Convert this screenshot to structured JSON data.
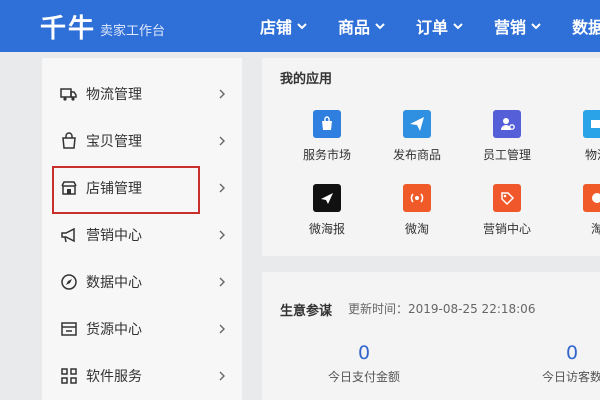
{
  "header": {
    "logo": "千牛",
    "subtitle": "卖家工作台",
    "nav": [
      "店铺",
      "商品",
      "订单",
      "营销",
      "数据"
    ]
  },
  "sidebar": {
    "items": [
      {
        "label": "物流管理",
        "icon": "truck-icon"
      },
      {
        "label": "宝贝管理",
        "icon": "bag-icon"
      },
      {
        "label": "店铺管理",
        "icon": "shop-icon",
        "selected": true
      },
      {
        "label": "营销中心",
        "icon": "megaphone-icon"
      },
      {
        "label": "数据中心",
        "icon": "compass-icon"
      },
      {
        "label": "货源中心",
        "icon": "box-icon"
      },
      {
        "label": "软件服务",
        "icon": "grid-icon"
      }
    ]
  },
  "apps": {
    "title": "我的应用",
    "items": [
      {
        "label": "服务市场",
        "icon": "market-bag-icon",
        "color": "#2f7fe0"
      },
      {
        "label": "发布商品",
        "icon": "send-icon",
        "color": "#2f8fe0"
      },
      {
        "label": "员工管理",
        "icon": "user-gear-icon",
        "color": "#5560d8"
      },
      {
        "label": "物流",
        "icon": "logistics-icon",
        "color": "#2aa3e8"
      },
      {
        "label": "微海报",
        "icon": "paper-plane-icon",
        "color": "#111111"
      },
      {
        "label": "微淘",
        "icon": "broadcast-icon",
        "color": "#f05a28"
      },
      {
        "label": "营销中心",
        "icon": "tag-icon",
        "color": "#f0572b"
      },
      {
        "label": "淘",
        "icon": "app-icon",
        "color": "#f05a28"
      }
    ]
  },
  "business": {
    "title": "生意参谋",
    "update_time": "更新时间：2019-08-25 22:18:06",
    "metrics": [
      {
        "value": "0",
        "label": "今日支付金额"
      },
      {
        "value": "0",
        "label": "今日访客数"
      }
    ]
  }
}
